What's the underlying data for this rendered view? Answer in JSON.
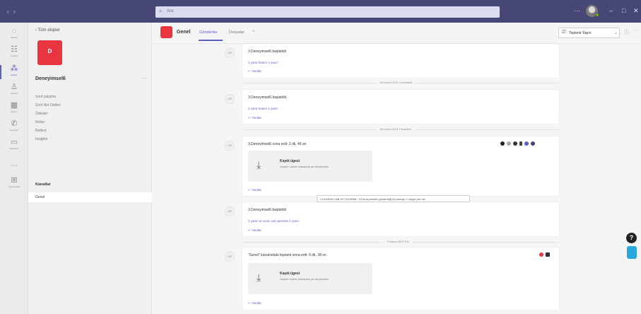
{
  "titlebar": {
    "back_glyph": "‹ ›",
    "search_placeholder": "Ara",
    "window_controls": [
      "···",
      "–",
      "□",
      "✕"
    ]
  },
  "rail": {
    "items": [
      {
        "label": "Etkinlik",
        "icon": "bell-icon"
      },
      {
        "label": "Sohbet",
        "icon": "chat-icon"
      },
      {
        "label": "Ekipler",
        "icon": "teams-icon",
        "active": true
      },
      {
        "label": "Ödevler",
        "icon": "assignments-icon"
      },
      {
        "label": "Takvim",
        "icon": "calendar-icon"
      },
      {
        "label": "Aramalar",
        "icon": "calls-icon"
      },
      {
        "label": "Dosyalar",
        "icon": "files-icon"
      },
      {
        "label": "···",
        "icon": "more-icon"
      },
      {
        "label": "Uygulamalar",
        "icon": "apps-icon"
      }
    ]
  },
  "team_panel": {
    "back_label": "‹  Tüm ekipler",
    "avatar_letter": "D",
    "team_name": "Deneyimsel6",
    "links": [
      "Sınıf çalışma",
      "Sınıf Not Defteri",
      "Ödevler",
      "Notlar",
      "Reflect",
      "Insights"
    ],
    "section_label": "Kanallar",
    "channel_label": "Genel"
  },
  "channel_header": {
    "name": "Genel",
    "tabs": [
      "Gönderiler",
      "Dosyalar"
    ],
    "plus": "+",
    "meet_label": "Toplantı Yapın",
    "info_glyph": "ⓘ",
    "more_glyph": "···"
  },
  "messages": [
    {
      "avatar": "CR",
      "title": "3.Deneyimsel6 başlatıldı",
      "link": "2 yanıt hanim 1 yanıt",
      "reply": "↩  Yanıtla"
    },
    {
      "avatar": "CR",
      "title": "3.Deneyimsel6 başlatıldı",
      "link": "2 yanıt hanim 1 yanıt",
      "reply": "↩  Yanıtla"
    },
    {
      "avatar": "CR",
      "title": "3.Deneyimsel6 sona erdi: 2 dk. 46 sn",
      "file_name": "Kaydı ügesi",
      "file_desc": "Kaydın süresi dolmadan ya da yeniden",
      "reply": "↩  Yanıtla"
    },
    {
      "avatar": "CR",
      "title": "3.Deneyimsel6 başlatıldı",
      "link": "2 yanıt ve sona, adı üyesinin 1 yanıt",
      "reply": "↩  Yanıtla"
    },
    {
      "avatar": "CR",
      "title": "\"Genel\" kanalındaki toplantı sona erdi: 6 dk. 28 sn",
      "file_name": "Kaydı ügesi",
      "file_desc": "Kaydın süresi dolmadan ya da yeniden",
      "reply": "↩  Yanıtla"
    }
  ],
  "dividers": [
    "18 Kasım 2021 Cumartesi",
    "18 Kasım 2021 Pazartesi",
    "1 Kasım 2021 Pzt"
  ],
  "tooltip": "CLEARAS LAB 20 YILDIRIM - 3 Deneyimsel6 gönderdiği bu konuyu 1 kişiye izin ver",
  "help_glyph": "?"
}
